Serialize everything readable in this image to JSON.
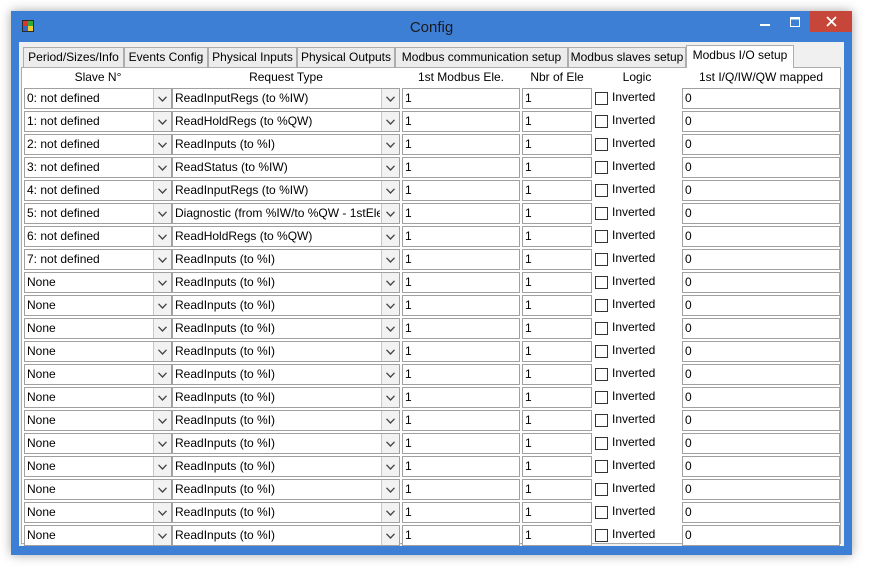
{
  "window": {
    "title": "Config",
    "accent": "#3e7fd6",
    "close_color": "#c7463a"
  },
  "tabs": [
    {
      "label": "Period/Sizes/Info",
      "active": false
    },
    {
      "label": "Events Config",
      "active": false
    },
    {
      "label": "Physical Inputs",
      "active": false
    },
    {
      "label": "Physical Outputs",
      "active": false
    },
    {
      "label": "Modbus communication setup",
      "active": false
    },
    {
      "label": "Modbus slaves setup",
      "active": false
    },
    {
      "label": "Modbus I/O setup",
      "active": true
    }
  ],
  "columns": {
    "slave": "Slave N°",
    "request": "Request Type",
    "first": "1st Modbus Ele.",
    "nbr": "Nbr of Ele",
    "logic": "Logic",
    "mapped": "1st I/Q/IW/QW mapped"
  },
  "rows": [
    {
      "slave": "0: not defined",
      "request": "ReadInputRegs (to %IW)",
      "first": "1",
      "nbr": "1",
      "logic": "Inverted",
      "mapped": "0"
    },
    {
      "slave": "1: not defined",
      "request": "ReadHoldRegs (to %QW)",
      "first": "1",
      "nbr": "1",
      "logic": "Inverted",
      "mapped": "0"
    },
    {
      "slave": "2: not defined",
      "request": "ReadInputs (to %I)",
      "first": "1",
      "nbr": "1",
      "logic": "Inverted",
      "mapped": "0"
    },
    {
      "slave": "3: not defined",
      "request": "ReadStatus (to %IW)",
      "first": "1",
      "nbr": "1",
      "logic": "Inverted",
      "mapped": "0"
    },
    {
      "slave": "4: not defined",
      "request": "ReadInputRegs (to %IW)",
      "first": "1",
      "nbr": "1",
      "logic": "Inverted",
      "mapped": "0"
    },
    {
      "slave": "5: not defined",
      "request": "Diagnostic (from %IW/to %QW - 1stEle",
      "first": "1",
      "nbr": "1",
      "logic": "Inverted",
      "mapped": "0"
    },
    {
      "slave": "6: not defined",
      "request": "ReadHoldRegs (to %QW)",
      "first": "1",
      "nbr": "1",
      "logic": "Inverted",
      "mapped": "0"
    },
    {
      "slave": "7: not defined",
      "request": "ReadInputs (to %I)",
      "first": "1",
      "nbr": "1",
      "logic": "Inverted",
      "mapped": "0"
    },
    {
      "slave": "None",
      "request": "ReadInputs (to %I)",
      "first": "1",
      "nbr": "1",
      "logic": "Inverted",
      "mapped": "0"
    },
    {
      "slave": "None",
      "request": "ReadInputs (to %I)",
      "first": "1",
      "nbr": "1",
      "logic": "Inverted",
      "mapped": "0"
    },
    {
      "slave": "None",
      "request": "ReadInputs (to %I)",
      "first": "1",
      "nbr": "1",
      "logic": "Inverted",
      "mapped": "0"
    },
    {
      "slave": "None",
      "request": "ReadInputs (to %I)",
      "first": "1",
      "nbr": "1",
      "logic": "Inverted",
      "mapped": "0"
    },
    {
      "slave": "None",
      "request": "ReadInputs (to %I)",
      "first": "1",
      "nbr": "1",
      "logic": "Inverted",
      "mapped": "0"
    },
    {
      "slave": "None",
      "request": "ReadInputs (to %I)",
      "first": "1",
      "nbr": "1",
      "logic": "Inverted",
      "mapped": "0"
    },
    {
      "slave": "None",
      "request": "ReadInputs (to %I)",
      "first": "1",
      "nbr": "1",
      "logic": "Inverted",
      "mapped": "0"
    },
    {
      "slave": "None",
      "request": "ReadInputs (to %I)",
      "first": "1",
      "nbr": "1",
      "logic": "Inverted",
      "mapped": "0"
    },
    {
      "slave": "None",
      "request": "ReadInputs (to %I)",
      "first": "1",
      "nbr": "1",
      "logic": "Inverted",
      "mapped": "0"
    },
    {
      "slave": "None",
      "request": "ReadInputs (to %I)",
      "first": "1",
      "nbr": "1",
      "logic": "Inverted",
      "mapped": "0"
    },
    {
      "slave": "None",
      "request": "ReadInputs (to %I)",
      "first": "1",
      "nbr": "1",
      "logic": "Inverted",
      "mapped": "0"
    },
    {
      "slave": "None",
      "request": "ReadInputs (to %I)",
      "first": "1",
      "nbr": "1",
      "logic": "Inverted",
      "mapped": "0"
    }
  ],
  "icons": {
    "app": "app-icon",
    "minimize": "minimize-icon",
    "maximize": "maximize-icon",
    "close": "close-icon",
    "dropdown": "chevron-down-icon"
  }
}
